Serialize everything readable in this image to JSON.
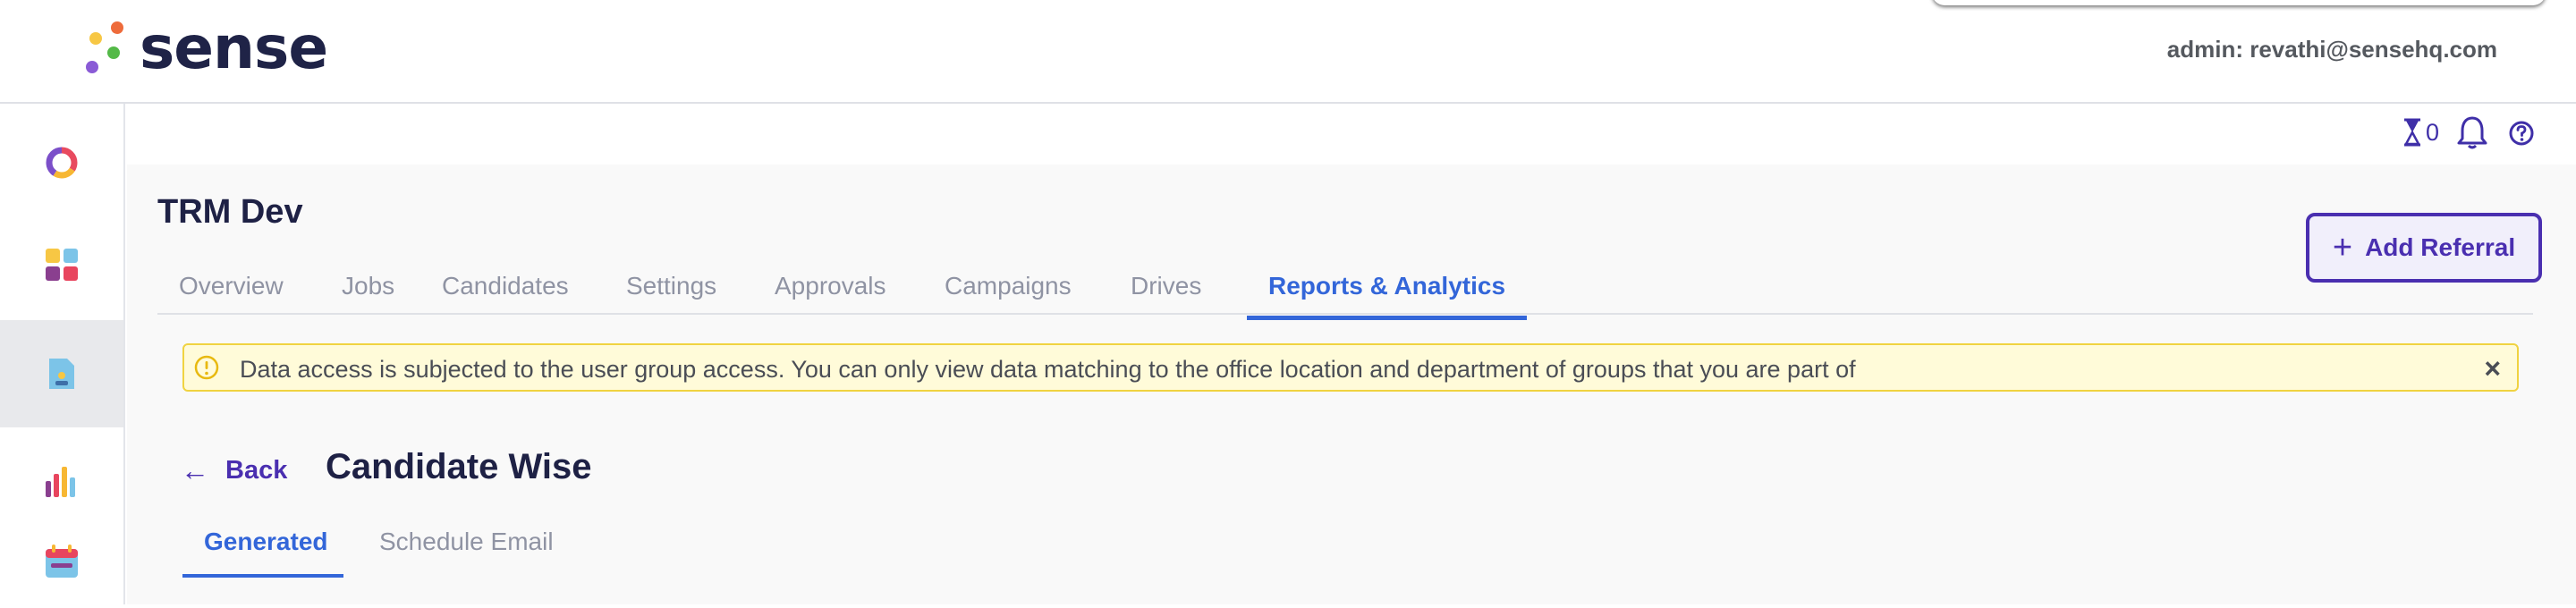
{
  "header": {
    "logo_text": "sense",
    "admin_label": "admin: revathi@sensehq.com"
  },
  "sidebar": {
    "items": [
      {
        "icon": "donut-chart-icon"
      },
      {
        "icon": "grid-apps-icon"
      },
      {
        "icon": "document-user-icon",
        "active": true
      },
      {
        "icon": "bar-chart-icon"
      },
      {
        "icon": "calendar-icon"
      }
    ]
  },
  "utilities": {
    "timer_count": "0",
    "icons": [
      "hourglass-icon",
      "bell-icon",
      "help-icon"
    ]
  },
  "project": {
    "title": "TRM Dev"
  },
  "tabs": [
    {
      "label": "Overview"
    },
    {
      "label": "Jobs"
    },
    {
      "label": "Candidates"
    },
    {
      "label": "Settings"
    },
    {
      "label": "Approvals"
    },
    {
      "label": "Campaigns"
    },
    {
      "label": "Drives"
    },
    {
      "label": "Reports & Analytics",
      "active": true
    }
  ],
  "actions": {
    "add_referral_label": "Add Referral"
  },
  "banner": {
    "text": "Data access is subjected to the user group access. You can only view data matching to the office location and department of groups that you are part of",
    "close_glyph": "×"
  },
  "page": {
    "back_label": "Back",
    "title": "Candidate Wise"
  },
  "subtabs": [
    {
      "label": "Generated",
      "active": true
    },
    {
      "label": "Schedule Email"
    }
  ],
  "colors": {
    "accent_purple": "#4a2fb0",
    "active_tab_blue": "#3366d9",
    "banner_bg": "#fffbd9",
    "banner_border": "#f0d341"
  }
}
